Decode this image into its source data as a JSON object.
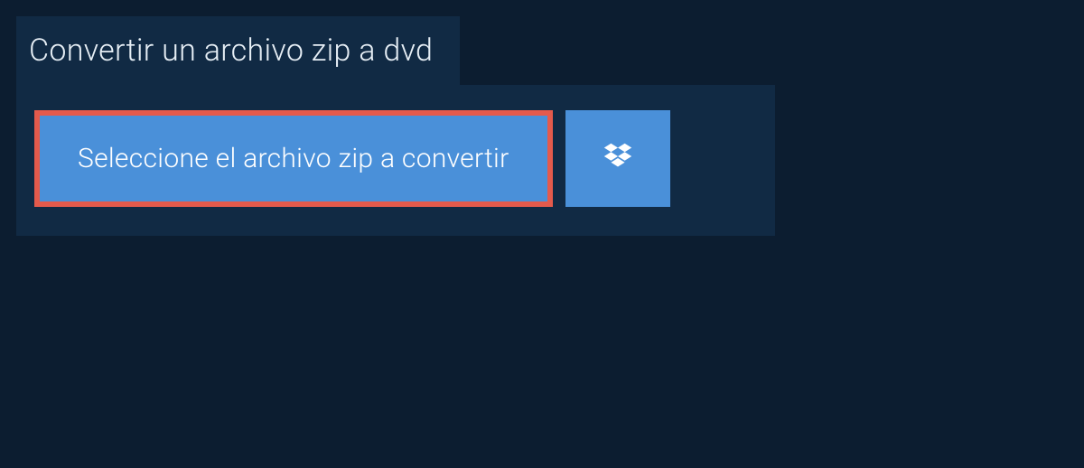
{
  "header": {
    "title": "Convertir un archivo zip a dvd"
  },
  "actions": {
    "select_file_label": "Seleccione el archivo zip a convertir",
    "dropbox_icon": "dropbox"
  },
  "colors": {
    "page_bg": "#0c1d30",
    "panel_bg": "#112a44",
    "button_bg": "#4a90d9",
    "highlight_border": "#e45a4c",
    "text_light": "#e6eef5",
    "text_white": "#ffffff"
  }
}
